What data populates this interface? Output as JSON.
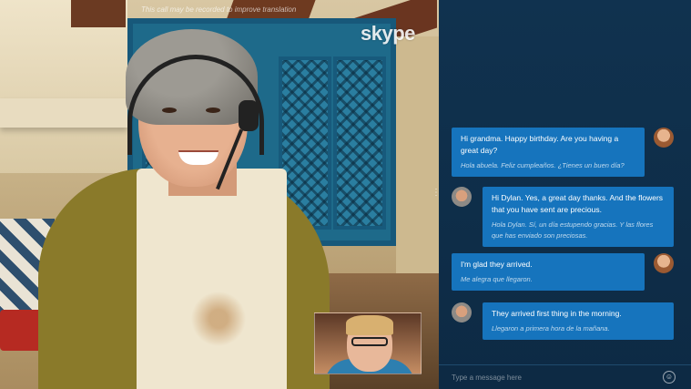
{
  "app": {
    "name": "skype"
  },
  "call": {
    "recording_notice": "This call may be recorded to improve translation"
  },
  "messages": [
    {
      "sender": "me",
      "text": "Hi grandma. Happy birthday. Are you having a great day?",
      "translation": "Hola abuela. Feliz cumpleaños. ¿Tienes un buen día?"
    },
    {
      "sender": "grandma",
      "text": "Hi Dylan. Yes, a great day thanks. And the flowers that you have sent are precious.",
      "translation": "Hola Dylan. Sí, un día estupendo gracias. Y las flores que has enviado son preciosas."
    },
    {
      "sender": "me",
      "text": "I'm glad they arrived.",
      "translation": "Me alegra que llegaron."
    },
    {
      "sender": "grandma",
      "text": "They arrived first thing in the morning.",
      "translation": "Llegaron a primera hora de la mañana."
    }
  ],
  "composer": {
    "placeholder": "Type a message here",
    "emoji_icon": "☺"
  },
  "colors": {
    "chat_bg": "#0d2a44",
    "bubble": "#1674bd"
  }
}
